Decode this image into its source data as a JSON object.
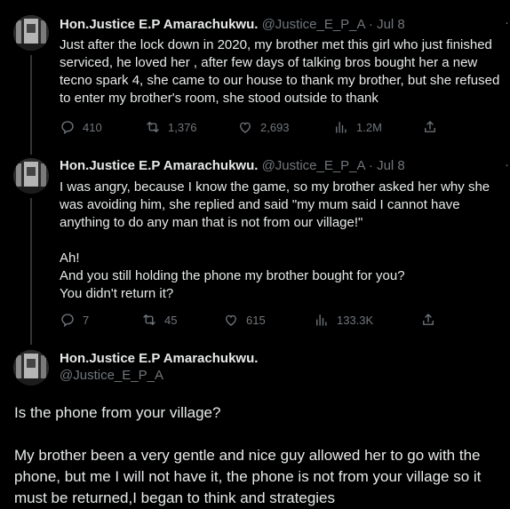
{
  "tweets": [
    {
      "name": "Hon.Justice E.P Amarachukwu.",
      "handle": "@Justice_E_P_A",
      "dot": "·",
      "time": "Jul 8",
      "text": "Just after the lock down in 2020, my brother met this girl who just finished\nserviced, he loved her , after few days of talking bros bought her a new\ntecno spark 4, she came to our house to thank my brother, but she refused\nto enter my brother's room, she stood outside to thank",
      "replies": "410",
      "retweets": "1,376",
      "likes": "2,693",
      "views": "1.2M"
    },
    {
      "name": "Hon.Justice E.P Amarachukwu.",
      "handle": "@Justice_E_P_A",
      "dot": "·",
      "time": "Jul 8",
      "text": "I was angry, because I know the game, so my brother asked her why she\nwas avoiding him, she replied and said \"my mum said I cannot have\nanything to do any man that is not from our village!\"\n\nAh!\nAnd you still holding the phone my brother bought for you?\nYou didn't return it?",
      "replies": "7",
      "retweets": "45",
      "likes": "615",
      "views": "133.3K"
    }
  ],
  "main_tweet": {
    "name": "Hon.Justice E.P Amarachukwu.",
    "handle": "@Justice_E_P_A",
    "text": "Is the phone from your village?\n\nMy brother been a very gentle and nice guy allowed her to go with the\nphone, but me I will not have it, the phone is not from your village so it\nmust be returned,I began to think and strategies"
  },
  "icons": {
    "reply": "reply-icon",
    "retweet": "retweet-icon",
    "like": "heart-icon",
    "views": "views-icon",
    "share": "share-icon",
    "more": "more-icon"
  },
  "colors": {
    "background": "#000000",
    "text": "#e7e9ea",
    "muted": "#71767b",
    "thread_line": "#333639"
  }
}
